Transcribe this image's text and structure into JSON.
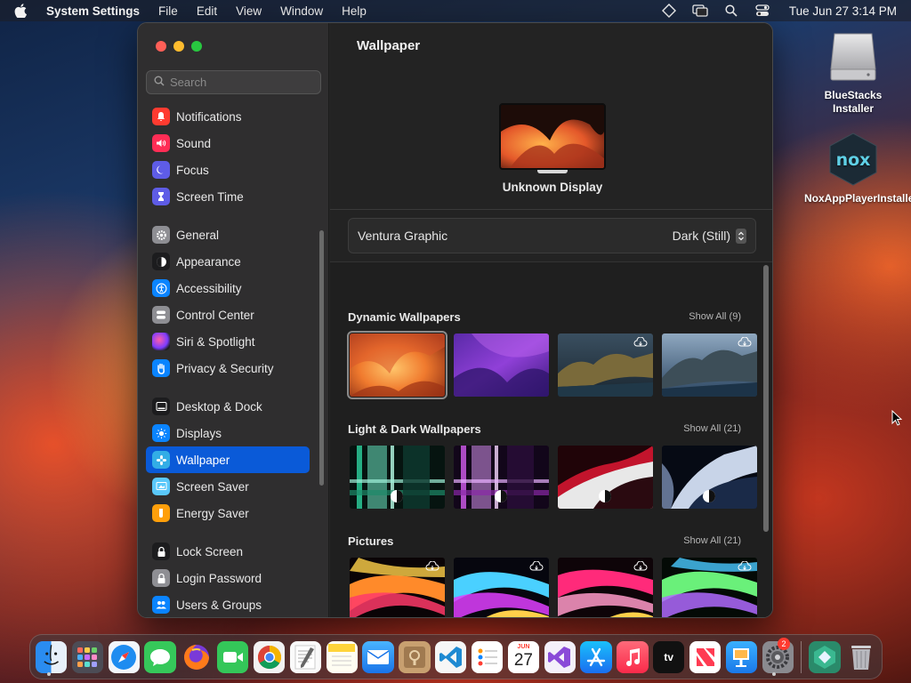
{
  "menubar": {
    "app": "System Settings",
    "items": [
      "File",
      "Edit",
      "View",
      "Window",
      "Help"
    ],
    "clock": "Tue Jun 27  3:14 PM"
  },
  "desktop": {
    "icons": [
      {
        "label": "BlueStacks Installer",
        "icon": "disk-drive-icon"
      },
      {
        "label": "NoxAppPlayerInstaller",
        "icon": "nox-app-icon"
      }
    ]
  },
  "window": {
    "search_placeholder": "Search",
    "sidebar": {
      "groups": [
        [
          {
            "label": "Notifications",
            "icon": "bell-icon",
            "color": "#ff3b30"
          },
          {
            "label": "Sound",
            "icon": "speaker-icon",
            "color": "#ff2d55"
          },
          {
            "label": "Focus",
            "icon": "moon-icon",
            "color": "#5e5ce6"
          },
          {
            "label": "Screen Time",
            "icon": "hourglass-icon",
            "color": "#5e5ce6"
          }
        ],
        [
          {
            "label": "General",
            "icon": "gear-icon",
            "color": "#8e8e93"
          },
          {
            "label": "Appearance",
            "icon": "appearance-icon",
            "color": "#1c1c1e"
          },
          {
            "label": "Accessibility",
            "icon": "accessibility-icon",
            "color": "#0a84ff"
          },
          {
            "label": "Control Center",
            "icon": "control-center-icon",
            "color": "#8e8e93"
          },
          {
            "label": "Siri & Spotlight",
            "icon": "siri-icon",
            "color": "#bf5af2"
          },
          {
            "label": "Privacy & Security",
            "icon": "hand-icon",
            "color": "#0a84ff"
          }
        ],
        [
          {
            "label": "Desktop & Dock",
            "icon": "dock-icon",
            "color": "#1c1c1e"
          },
          {
            "label": "Displays",
            "icon": "sun-icon",
            "color": "#0a84ff"
          },
          {
            "label": "Wallpaper",
            "icon": "flower-icon",
            "color": "#32ade6",
            "selected": true
          },
          {
            "label": "Screen Saver",
            "icon": "screen-saver-icon",
            "color": "#5ac8fa"
          },
          {
            "label": "Energy Saver",
            "icon": "battery-icon",
            "color": "#ff9f0a"
          }
        ],
        [
          {
            "label": "Lock Screen",
            "icon": "lock-icon",
            "color": "#1c1c1e"
          },
          {
            "label": "Login Password",
            "icon": "key-lock-icon",
            "color": "#8e8e93"
          },
          {
            "label": "Users & Groups",
            "icon": "users-icon",
            "color": "#0a84ff"
          }
        ]
      ]
    },
    "content": {
      "title": "Wallpaper",
      "display_name": "Unknown Display",
      "current_wallpaper": "Ventura Graphic",
      "mode": "Dark (Still)",
      "sections": [
        {
          "title": "Dynamic Wallpapers",
          "show_all": "Show All (9)"
        },
        {
          "title": "Light & Dark Wallpapers",
          "show_all": "Show All (21)"
        },
        {
          "title": "Pictures",
          "show_all": "Show All (21)"
        }
      ]
    }
  },
  "dock": {
    "apps": [
      "Finder",
      "Launchpad",
      "Safari",
      "Messages",
      "Firefox",
      "FaceTime",
      "Chrome",
      "TextEdit",
      "Notes",
      "Mail",
      "Keychain",
      "VS Code",
      "Reminders",
      "Calendar",
      "Visual Studio",
      "App Store",
      "Music",
      "TV",
      "News",
      "Keynote",
      "System Settings",
      "BlueStacks",
      "Trash"
    ],
    "calendar_month": "JUN",
    "calendar_day": "27",
    "tv_label": "tv",
    "settings_badge": "2"
  }
}
